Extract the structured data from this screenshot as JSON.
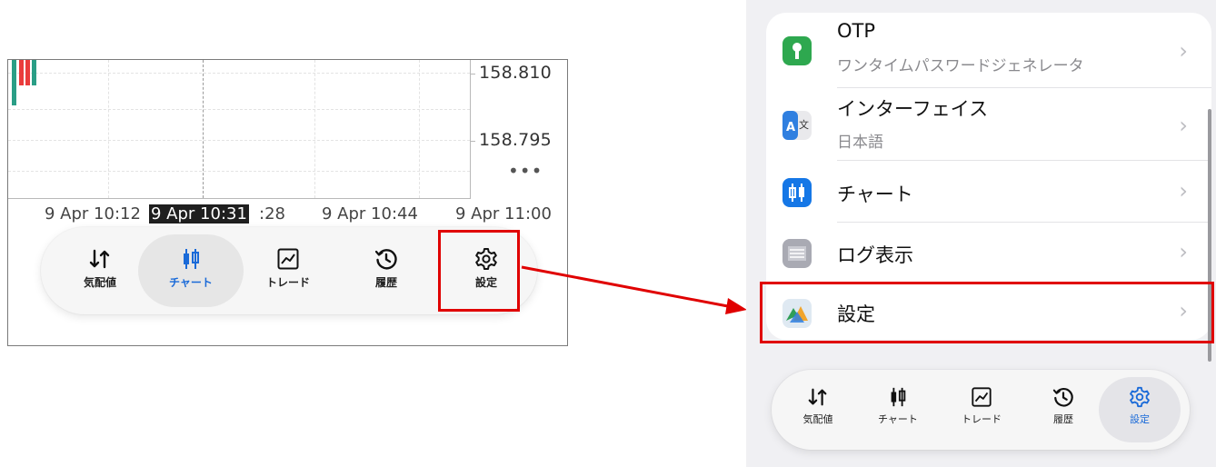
{
  "left_chart": {
    "price_labels": [
      "158.810",
      "158.795"
    ],
    "more_label": "•••",
    "time_labels": [
      "9 Apr 10:12",
      "9 Apr 10:31",
      ":28",
      "9 Apr 10:44",
      "9 Apr 11:00"
    ],
    "candle_colors": [
      "#ea3b3b",
      "#2a9e86"
    ]
  },
  "left_tabbar": {
    "tabs": [
      {
        "label": "気配値",
        "icon": "quotes-arrows-icon"
      },
      {
        "label": "チャート",
        "icon": "candlestick-icon",
        "active": true
      },
      {
        "label": "トレード",
        "icon": "trade-chart-icon"
      },
      {
        "label": "履歴",
        "icon": "history-clock-icon"
      },
      {
        "label": "設定",
        "icon": "gear-icon"
      }
    ]
  },
  "settings_list": {
    "rows": [
      {
        "title": "OTP",
        "subtitle": "ワンタイムパスワードジェネレータ",
        "icon": "key-icon",
        "icon_color": "#2ea84f"
      },
      {
        "title": "インターフェイス",
        "subtitle": "日本語",
        "icon": "translate-icon",
        "icon_color": "#2f7fe0"
      },
      {
        "title": "チャート",
        "subtitle": "",
        "icon": "candlestick-icon",
        "icon_color": "#1577e6"
      },
      {
        "title": "ログ表示",
        "subtitle": "",
        "icon": "document-icon",
        "icon_color": "#a9aab3"
      },
      {
        "title": "設定",
        "subtitle": "",
        "icon": "metatrader-icon",
        "icon_color": "#4aa0d8"
      }
    ],
    "chevron": "›"
  },
  "right_tabbar": {
    "tabs": [
      {
        "label": "気配値",
        "icon": "quotes-arrows-icon"
      },
      {
        "label": "チャート",
        "icon": "candlestick-icon"
      },
      {
        "label": "トレード",
        "icon": "trade-chart-icon"
      },
      {
        "label": "履歴",
        "icon": "history-clock-icon"
      },
      {
        "label": "設定",
        "icon": "gear-icon",
        "active": true
      }
    ]
  },
  "colors": {
    "accent": "#1a6ad8",
    "highlight_box": "#e00000",
    "arrow": "#e00000"
  }
}
